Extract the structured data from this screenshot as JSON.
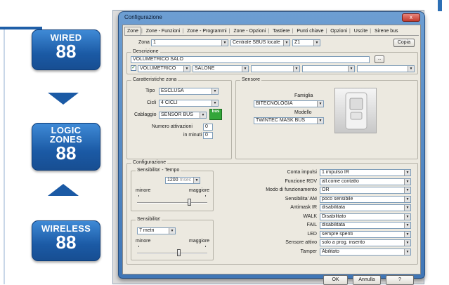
{
  "badges": [
    {
      "title_line1": "WIRED",
      "title_line2": "",
      "title_line3": "",
      "number": "88"
    },
    {
      "title_line1": "LOGIC",
      "title_line2": "ZONES",
      "title_line3": "",
      "number": "88"
    },
    {
      "title_line1": "WIRELESS",
      "title_line2": "",
      "title_line3": "",
      "number": "88"
    }
  ],
  "window": {
    "title": "Configurazione",
    "close_label": "x"
  },
  "tabs": [
    "Zone",
    "Zone - Funzioni",
    "Zone - Programmi",
    "Zone - Opzioni",
    "Tastiere",
    "Punti chiave",
    "Opzioni",
    "Uscite",
    "Sirene bus"
  ],
  "zone_row": {
    "zona_label": "Zona",
    "zona_value": "1",
    "centrale_value": "Centrale SBUS locale",
    "zone_code": "Z1",
    "copia_label": "Copia"
  },
  "descrizione": {
    "title": "Descrizione",
    "value": "VOLUMETRICO SALO",
    "icon_label": "...",
    "checkbox_checked": true,
    "dropdowns": [
      "VOLUMETRICO",
      "SALONE",
      "",
      "",
      ""
    ]
  },
  "caratteristiche": {
    "title": "Caratteristiche zona",
    "tipo_label": "Tipo",
    "tipo_value": "ESCLUSA",
    "cicli_label": "Cicli",
    "cicli_value": "4 CICLI",
    "cablaggio_label": "Cablaggio",
    "cablaggio_value": "SENSOR BUS",
    "bus_icon_label": "bus",
    "attivazioni_label": "Numero attivazioni",
    "attivazioni_value": "0",
    "minuti_label": "in minuti",
    "minuti_value": "0"
  },
  "sensore": {
    "title": "Sensore",
    "famiglia_label": "Famiglia",
    "famiglia_value": "BITECNOLOGIA",
    "modello_label": "Modello",
    "modello_value": "TWINTEC MASK BUS"
  },
  "configurazione": {
    "title": "Configurazione",
    "sens_tempo": {
      "title": "Sensibilita' - Tempo",
      "value": "1200",
      "unit": "msec",
      "minore": "minore",
      "maggiore": "maggiore",
      "slider_fraction": 0.75
    },
    "sensibilita": {
      "title": "Sensibilita'",
      "value": "7 metri",
      "minore": "minore",
      "maggiore": "maggiore",
      "slider_fraction": 0.6
    },
    "params": [
      {
        "label": "Conta impulsi",
        "value": "1 impulso IR"
      },
      {
        "label": "Funzione RDV",
        "value": "all.come contatto"
      },
      {
        "label": "Modo di funzionamento",
        "value": "OR"
      },
      {
        "label": "Sensibilita' AM",
        "value": "poco sensibile"
      },
      {
        "label": "Antimask IR",
        "value": "disabilitata"
      },
      {
        "label": "WALK",
        "value": "Disabilitato"
      },
      {
        "label": "FAIL",
        "value": "disabilitata"
      },
      {
        "label": "LED",
        "value": "sempre spenti"
      },
      {
        "label": "Sensore attivo",
        "value": "solo a prog. inserito"
      },
      {
        "label": "Tamper",
        "value": "Abilitato"
      }
    ]
  },
  "footer": {
    "ok": "OK",
    "annulla": "Annulla",
    "help": "?"
  },
  "colors": {
    "badge_blue": "#1b5aa5",
    "window_frame": "#3f76b6",
    "dialog_bg": "#ece9e0"
  }
}
